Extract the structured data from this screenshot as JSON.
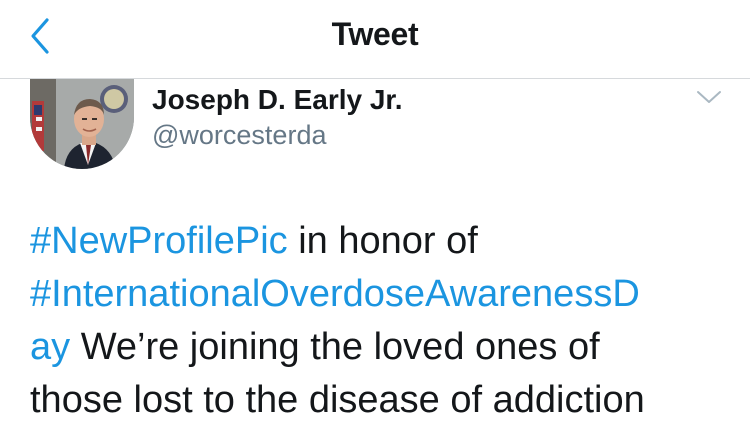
{
  "header": {
    "title": "Tweet",
    "back_icon": "chevron-left-icon"
  },
  "tweet": {
    "author_name": "Joseph D. Early Jr.",
    "author_handle": "@worcesterda",
    "more_icon": "chevron-down-icon",
    "hashtag_1": "#NewProfilePic",
    "text_1": " in honor of",
    "hashtag_2_line_1": "#InternationalOverdoseAwarenessD",
    "hashtag_2_line_2": "ay",
    "text_2": " We’re joining the loved ones of",
    "text_3": "those lost to the disease of addiction"
  },
  "colors": {
    "link": "#1b95e0",
    "text": "#14171a",
    "secondary_text": "#657786",
    "divider": "#d6d9dc"
  }
}
